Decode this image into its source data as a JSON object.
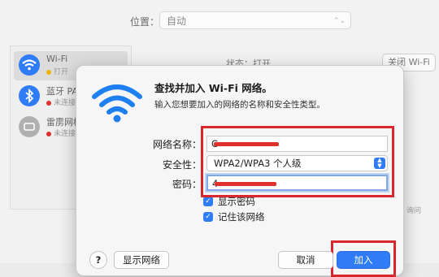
{
  "background": {
    "location_label": "位置：",
    "location_value": "自动",
    "sidebar_items": [
      {
        "name": "Wi-Fi",
        "status": "打开",
        "dot": "#f0b400",
        "icon_color": "#2f7cf6"
      },
      {
        "name": "蓝牙 PAN",
        "status": "未连接",
        "dot": "#e0302c",
        "icon_color": "#2f7cf6"
      },
      {
        "name": "雷雳网桥",
        "status": "未连接",
        "dot": "#e0302c",
        "icon_color": "#b0b0b0"
      }
    ],
    "status_text": "状态：打开",
    "wifi_off_button": "关闭 Wi-Fi",
    "right_faint_text": "询问"
  },
  "dialog": {
    "title": "查找并加入 Wi-Fi 网络。",
    "subtitle": "输入您想要加入的网络的名称和安全性类型。",
    "network_name_label": "网络名称：",
    "network_name_value": "C",
    "security_label": "安全性：",
    "security_value": "WPA2/WPA3 个人级",
    "password_label": "密码：",
    "password_value": "4",
    "show_password_label": "显示密码",
    "remember_network_label": "记住该网络",
    "help_button": "?",
    "show_networks_button": "显示网络",
    "cancel_button": "取消",
    "join_button": "加入"
  },
  "colors": {
    "accent": "#2f7cf6",
    "annotation_red": "#d9272e"
  }
}
